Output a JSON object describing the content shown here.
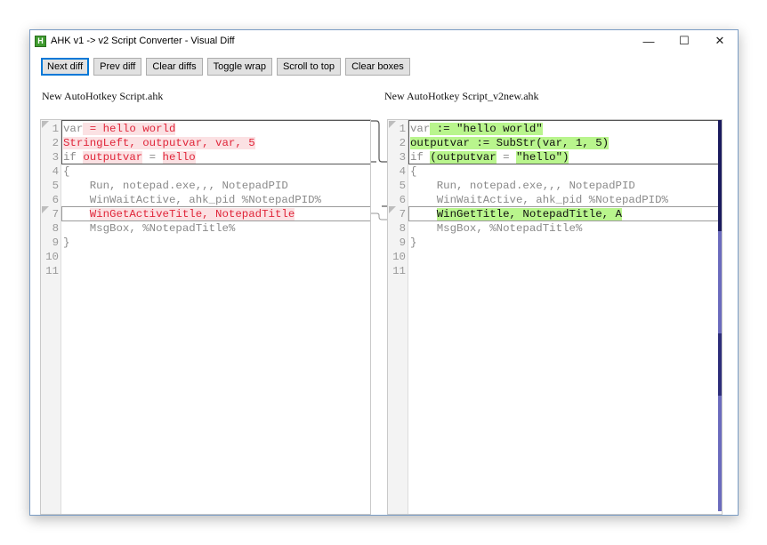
{
  "window": {
    "title": "AHK v1 -> v2 Script Converter - Visual Diff",
    "icon_letter": "H",
    "controls": {
      "minimize": "—",
      "maximize": "☐",
      "close": "✕"
    }
  },
  "toolbar": {
    "buttons": [
      {
        "label": "Next diff"
      },
      {
        "label": "Prev diff"
      },
      {
        "label": "Clear diffs"
      },
      {
        "label": "Toggle wrap"
      },
      {
        "label": "Scroll to top"
      },
      {
        "label": "Clear boxes"
      }
    ]
  },
  "left": {
    "title": "New AutoHotkey Script.ahk",
    "line_numbers": [
      "1",
      "2",
      "3",
      "4",
      "5",
      "6",
      "7",
      "8",
      "9",
      "10",
      "11"
    ],
    "lines": [
      {
        "segments": [
          {
            "t": "var",
            "k": "plain"
          },
          {
            "t": " = hello world",
            "k": "chg"
          }
        ]
      },
      {
        "segments": [
          {
            "t": "StringLeft, outputvar, var, 5",
            "k": "chg"
          }
        ]
      },
      {
        "segments": [
          {
            "t": "if ",
            "k": "plain"
          },
          {
            "t": "outputvar",
            "k": "chg"
          },
          {
            "t": " = ",
            "k": "plain"
          },
          {
            "t": "hello",
            "k": "chg"
          }
        ]
      },
      {
        "segments": [
          {
            "t": "{",
            "k": "plain"
          }
        ]
      },
      {
        "segments": [
          {
            "t": "    Run, notepad.exe,,, NotepadPID",
            "k": "plain"
          }
        ]
      },
      {
        "segments": [
          {
            "t": "    WinWaitActive, ahk_pid %NotepadPID%",
            "k": "plain"
          }
        ]
      },
      {
        "segments": [
          {
            "t": "    ",
            "k": "plain"
          },
          {
            "t": "WinGetActiveTitle, NotepadTitle",
            "k": "chg"
          }
        ]
      },
      {
        "segments": [
          {
            "t": "    MsgBox, %NotepadTitle%",
            "k": "plain"
          }
        ]
      },
      {
        "segments": [
          {
            "t": "}",
            "k": "plain"
          }
        ]
      },
      {
        "segments": []
      },
      {
        "segments": []
      }
    ]
  },
  "right": {
    "title": "New AutoHotkey Script_v2new.ahk",
    "line_numbers": [
      "1",
      "2",
      "3",
      "4",
      "5",
      "6",
      "7",
      "8",
      "9",
      "10",
      "11"
    ],
    "lines": [
      {
        "segments": [
          {
            "t": "var",
            "k": "plain"
          },
          {
            "t": " := \"hello world\"",
            "k": "chgtxt"
          }
        ]
      },
      {
        "segments": [
          {
            "t": "outputvar := SubStr(var, 1, 5)",
            "k": "chgtxt"
          }
        ]
      },
      {
        "segments": [
          {
            "t": "if ",
            "k": "plain"
          },
          {
            "t": "(outputvar",
            "k": "chgtxt"
          },
          {
            "t": " = ",
            "k": "plain"
          },
          {
            "t": "\"hello\")",
            "k": "chgtxt"
          }
        ]
      },
      {
        "segments": [
          {
            "t": "{",
            "k": "plain"
          }
        ]
      },
      {
        "segments": [
          {
            "t": "    Run, notepad.exe,,, NotepadPID",
            "k": "plain"
          }
        ]
      },
      {
        "segments": [
          {
            "t": "    WinWaitActive, ahk_pid %NotepadPID%",
            "k": "plain"
          }
        ]
      },
      {
        "segments": [
          {
            "t": "    ",
            "k": "plain"
          },
          {
            "t": "WinGetTitle, NotepadTitle, A",
            "k": "chgtxt"
          }
        ]
      },
      {
        "segments": [
          {
            "t": "    MsgBox, %NotepadTitle%",
            "k": "plain"
          }
        ]
      },
      {
        "segments": [
          {
            "t": "}",
            "k": "plain"
          }
        ]
      },
      {
        "segments": []
      },
      {
        "segments": []
      }
    ]
  },
  "colors": {
    "removed_text": "#e0263a",
    "removed_bg": "#fbe1e3",
    "added_bg": "#b9f58d",
    "scroll_track": "#6b6bbd"
  }
}
